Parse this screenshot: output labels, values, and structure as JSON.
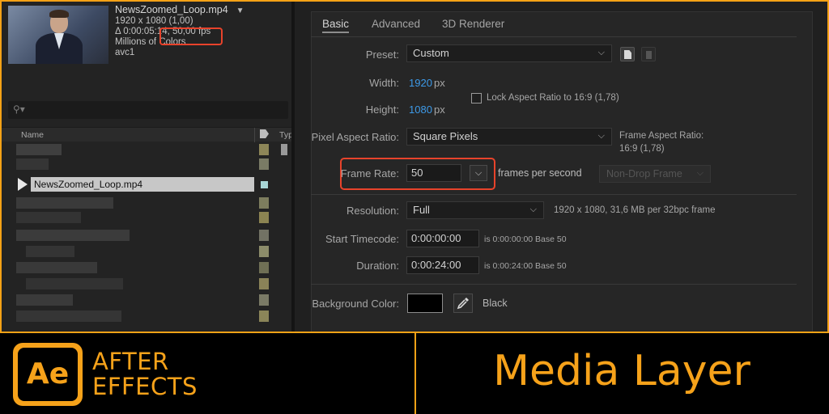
{
  "project": {
    "file_name": "NewsZoomed_Loop.mp4",
    "meta_lines": [
      "1920 x 1080 (1,00)",
      "Δ 0:00:05:14, 50,00 fps",
      "Millions of Colors",
      "avc1"
    ],
    "column_name": "Name",
    "column_type": "Typ",
    "selected_item": "NewsZoomed_Loop.mp4"
  },
  "comp_settings": {
    "tabs": [
      "Basic",
      "Advanced",
      "3D Renderer"
    ],
    "preset_label": "Preset:",
    "preset_value": "Custom",
    "width_label": "Width:",
    "width_value": "1920",
    "height_label": "Height:",
    "height_value": "1080",
    "px": "px",
    "lock_aspect": "Lock Aspect Ratio to 16:9 (1,78)",
    "pixel_aspect_label": "Pixel Aspect Ratio:",
    "pixel_aspect_value": "Square Pixels",
    "frame_aspect_label": "Frame Aspect Ratio:",
    "frame_aspect_value": "16:9 (1,78)",
    "frame_rate_label": "Frame Rate:",
    "frame_rate_value": "50",
    "frames_per_second": "frames per second",
    "drop_frame": "Non-Drop Frame",
    "resolution_label": "Resolution:",
    "resolution_value": "Full",
    "resolution_info": "1920 x 1080, 31,6 MB per 32bpc frame",
    "start_timecode_label": "Start Timecode:",
    "start_timecode_value": "0:00:00:00",
    "start_timecode_info": "is 0:00:00:00  Base 50",
    "duration_label": "Duration:",
    "duration_value": "0:00:24:00",
    "duration_info": "is 0:00:24:00  Base 50",
    "bg_color_label": "Background Color:",
    "bg_color_name": "Black"
  },
  "banner": {
    "logo_text": "Ae",
    "brand_line1": "AFTER",
    "brand_line2": "EFFECTS",
    "title": "Media Layer"
  },
  "colors": {
    "accent": "#f6a21a",
    "highlight_box": "#e8432b",
    "link_blue": "#3d9ae8"
  }
}
